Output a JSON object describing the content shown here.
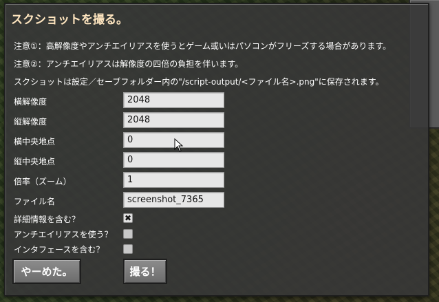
{
  "dialog": {
    "title": "スクショットを撮る。",
    "notes": [
      "注意①：高解像度やアンチエイリアスを使うとゲーム或いはパソコンがフリーズする場合があります。",
      "注意②：アンチエイリアスは解像度の四倍の負担を伴います。",
      "スクショットは設定／セーブフォルダー内の\"/script-output/<ファイル名>.png\"に保存されます。"
    ],
    "fields": [
      {
        "label": "横解像度",
        "value": "2048"
      },
      {
        "label": "縦解像度",
        "value": "2048"
      },
      {
        "label": "横中央地点",
        "value": "0"
      },
      {
        "label": "縦中央地点",
        "value": "0"
      },
      {
        "label": "倍率（ズーム）",
        "value": "1"
      },
      {
        "label": "ファイル名",
        "value": "screenshot_7365"
      }
    ],
    "checkboxes": [
      {
        "label": "詳細情報を含む？",
        "checked": true,
        "mark": "✖"
      },
      {
        "label": "アンチエイリアスを使う？",
        "checked": false,
        "mark": ""
      },
      {
        "label": "インタフェースを含む？",
        "checked": false,
        "mark": ""
      }
    ],
    "buttons": {
      "cancel": "やーめた。",
      "confirm": "撮る！"
    }
  }
}
